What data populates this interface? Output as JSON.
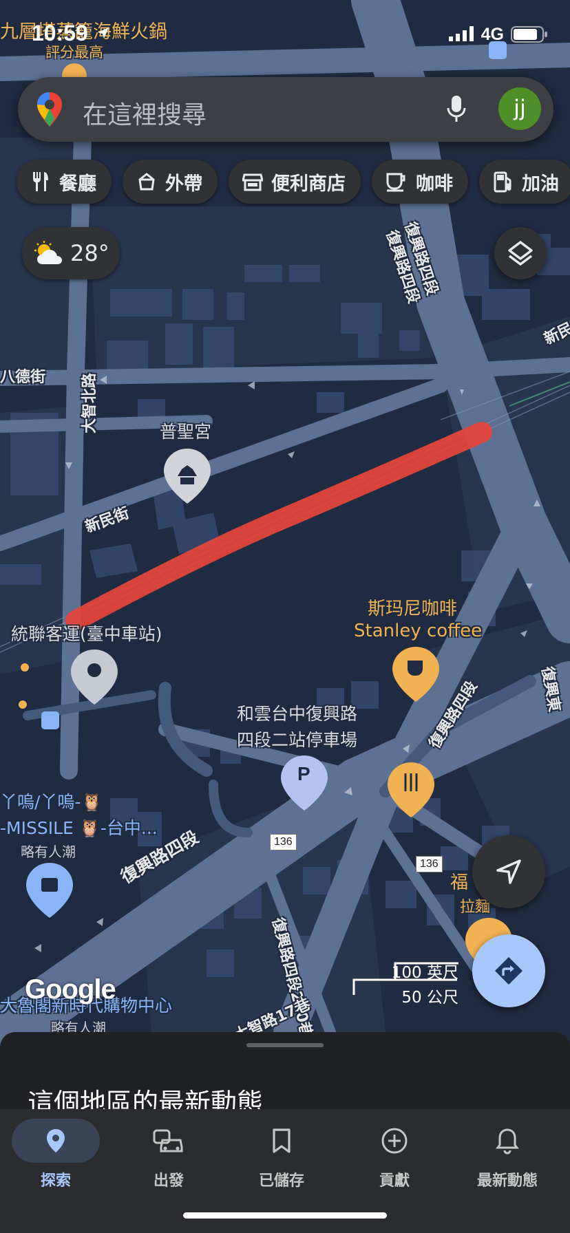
{
  "status_bar": {
    "time": "10:59",
    "network": "4G"
  },
  "search": {
    "placeholder": "在這裡搜尋",
    "avatar_initials": "jj"
  },
  "chips": [
    {
      "label": "餐廳",
      "icon": "fork-knife-icon"
    },
    {
      "label": "外帶",
      "icon": "takeout-icon"
    },
    {
      "label": "便利商店",
      "icon": "store-icon"
    },
    {
      "label": "咖啡",
      "icon": "coffee-icon"
    },
    {
      "label": "加油",
      "icon": "gas-icon"
    }
  ],
  "weather": {
    "temperature": "28°",
    "icon": "partly-cloudy-icon"
  },
  "map": {
    "top_poi": {
      "name": "九層塔蒸籠海鮮火鍋",
      "subtitle": "評分最高"
    },
    "streets": {
      "bade": "八德街",
      "dazhi_north": "大智北路",
      "xinmin": "新民街",
      "fuxing_4_top": "復興路四段",
      "fuxing_4_mid": "復興路四段",
      "fuxing_4_bottom": "復興路四段",
      "fuxing_4_lane220": "復興路四段220巷",
      "dazhi_lane17": "大智路17巷",
      "xin_right": "新民",
      "fuxing_right": "復興東"
    },
    "pois": {
      "temple": "普聖宮",
      "bus_station": "統聯客運(臺中車站)",
      "coffee_cn": "斯玛尼咖啡",
      "coffee_en": "Stanley coffee",
      "parking_line1": "和雲台中復興路",
      "parking_line2": "四段二站停車場",
      "shop_line1": "丫嗚/丫嗚-🦉",
      "shop_line2": "-MISSILE 🦉-台中...",
      "shop_sub": "略有人潮",
      "mall": "大魯閣新時代購物中心",
      "mall_sub": "略有人潮",
      "ramen_1": "福",
      "ramen_2": "拉麵"
    },
    "route_shields": [
      "136",
      "136"
    ],
    "highlight_color": "#e8453c"
  },
  "branding": {
    "logo": "Google"
  },
  "scale": {
    "imperial": "100 英尺",
    "metric": "50 公尺"
  },
  "sheet": {
    "title": "這個地區的最新動態"
  },
  "bottom_nav": [
    {
      "label": "探索",
      "icon": "location-pin-icon",
      "active": true
    },
    {
      "label": "出發",
      "icon": "car-icon",
      "active": false
    },
    {
      "label": "已儲存",
      "icon": "bookmark-icon",
      "active": false
    },
    {
      "label": "貢獻",
      "icon": "add-circle-icon",
      "active": false
    },
    {
      "label": "最新動態",
      "icon": "bell-icon",
      "active": false
    }
  ]
}
